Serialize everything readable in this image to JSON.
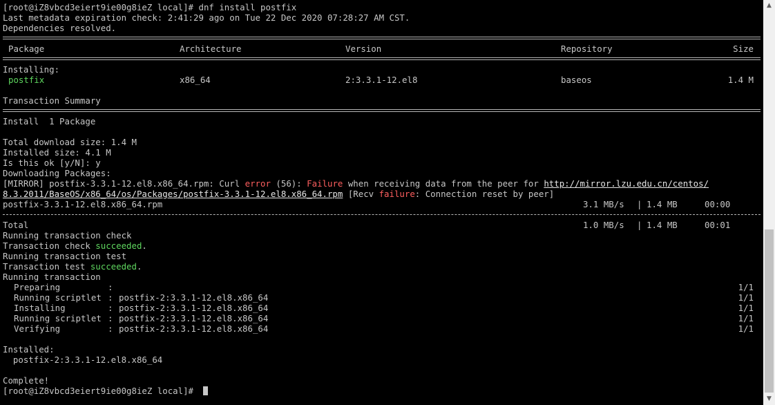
{
  "prompt": "[root@iZ8vbcd3eiert9ie00g8ieZ local]# ",
  "command": "dnf install postfix",
  "metadata_line": "Last metadata expiration check: 2:41:29 ago on Tue 22 Dec 2020 07:28:27 AM CST.",
  "deps_line": "Dependencies resolved.",
  "table": {
    "headers": [
      "Package",
      "Architecture",
      "Version",
      "Repository",
      "Size"
    ],
    "section": "Installing:",
    "rows": [
      {
        "package": "postfix",
        "arch": "x86_64",
        "version": "2:3.3.1-12.el8",
        "repo": "baseos",
        "size": "1.4 M"
      }
    ]
  },
  "summary": {
    "title": "Transaction Summary",
    "install_line": "Install  1 Package",
    "download_size": "Total download size: 1.4 M",
    "installed_size": "Installed size: 4.1 M",
    "confirm": "Is this ok [y/N]: y",
    "downloading": "Downloading Packages:"
  },
  "mirror": {
    "prefix": "[MIRROR] postfix-3.3.1-12.el8.x86_64.rpm: Curl ",
    "error_word": "error",
    "code": " (56): ",
    "failure_word": "Failure",
    "middle": " when receiving data from the peer for ",
    "url_part1": "http://mirror.lzu.edu.cn/centos/",
    "url_part2": "8.3.2011/BaseOS/x86_64/os/Packages/postfix-3.3.1-12.el8.x86_64.rpm",
    "recv_prefix": " [Recv ",
    "recv_failure": "failure",
    "recv_suffix": ": Connection reset by peer]"
  },
  "download": {
    "file": "postfix-3.3.1-12.el8.x86_64.rpm",
    "speed": "3.1 MB/s",
    "sep": "|",
    "size": "1.4 MB",
    "time": "00:00"
  },
  "total": {
    "label": "Total",
    "speed": "1.0 MB/s",
    "sep": "|",
    "size": "1.4 MB",
    "time": "00:01"
  },
  "transaction": {
    "check": "Running transaction check",
    "check_result_prefix": "Transaction check ",
    "succeeded": "succeeded",
    "dot": ".",
    "test": "Running transaction test",
    "test_result_prefix": "Transaction test ",
    "running": "Running transaction",
    "steps": [
      {
        "name": "Preparing",
        "pkg": "",
        "progress": "1/1"
      },
      {
        "name": "Running scriptlet",
        "pkg": "postfix-2:3.3.1-12.el8.x86_64",
        "progress": "1/1"
      },
      {
        "name": "Installing",
        "pkg": "postfix-2:3.3.1-12.el8.x86_64",
        "progress": "1/1"
      },
      {
        "name": "Running scriptlet",
        "pkg": "postfix-2:3.3.1-12.el8.x86_64",
        "progress": "1/1"
      },
      {
        "name": "Verifying",
        "pkg": "postfix-2:3.3.1-12.el8.x86_64",
        "progress": "1/1"
      }
    ],
    "colon": ":"
  },
  "installed": {
    "label": "Installed:",
    "pkg": "  postfix-2:3.3.1-12.el8.x86_64"
  },
  "complete": "Complete!",
  "colors": {
    "background": "#000000",
    "foreground": "#c7c7c7",
    "success": "#5fd75f",
    "error": "#ff5f5f"
  },
  "icons": {
    "scroll_up": "up-arrow-icon",
    "scroll_down": "down-arrow-icon"
  }
}
